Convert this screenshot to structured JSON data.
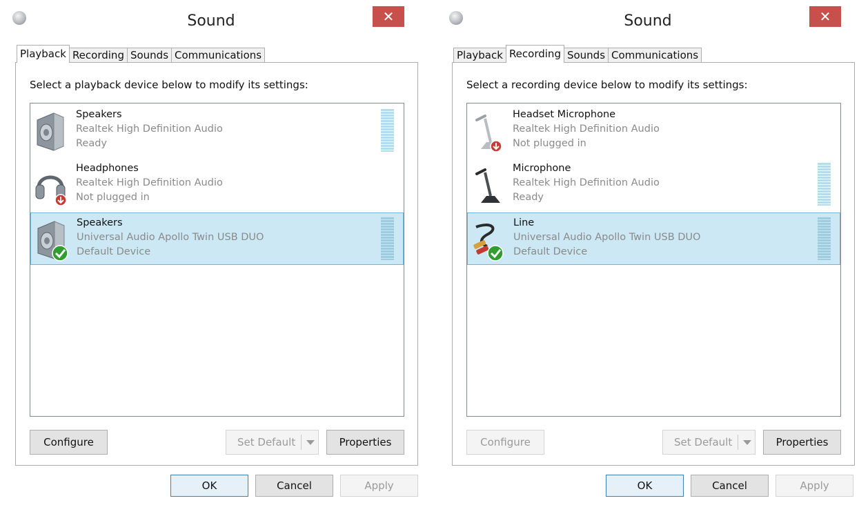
{
  "dialogs": [
    {
      "title": "Sound",
      "close_label": "✕",
      "tabs": [
        "Playback",
        "Recording",
        "Sounds",
        "Communications"
      ],
      "active_tab": "Playback",
      "instruction": "Select a playback device below to modify its settings:",
      "devices": [
        {
          "name": "Speakers",
          "driver": "Realtek High Definition Audio",
          "status": "Ready",
          "icon": "speaker-icon",
          "badge": "none",
          "meter": true,
          "selected": false
        },
        {
          "name": "Headphones",
          "driver": "Realtek High Definition Audio",
          "status": "Not plugged in",
          "icon": "headphones-icon",
          "badge": "unplugged",
          "meter": false,
          "selected": false
        },
        {
          "name": "Speakers",
          "driver": "Universal Audio Apollo Twin USB DUO",
          "status": "Default Device",
          "icon": "speaker-icon",
          "badge": "default-check",
          "meter": true,
          "selected": true
        }
      ],
      "buttons": {
        "configure": "Configure",
        "set_default": "Set Default",
        "properties": "Properties",
        "ok": "OK",
        "cancel": "Cancel",
        "apply": "Apply"
      },
      "configure_enabled": true
    },
    {
      "title": "Sound",
      "close_label": "✕",
      "tabs": [
        "Playback",
        "Recording",
        "Sounds",
        "Communications"
      ],
      "active_tab": "Recording",
      "instruction": "Select a recording device below to modify its settings:",
      "devices": [
        {
          "name": "Headset Microphone",
          "driver": "Realtek High Definition Audio",
          "status": "Not plugged in",
          "icon": "microphone-icon",
          "badge": "unplugged",
          "meter": false,
          "selected": false
        },
        {
          "name": "Microphone",
          "driver": "Realtek High Definition Audio",
          "status": "Ready",
          "icon": "microphone-icon",
          "badge": "none",
          "meter": true,
          "selected": false
        },
        {
          "name": "Line",
          "driver": "Universal Audio Apollo Twin USB DUO",
          "status": "Default Device",
          "icon": "line-in-cable-icon",
          "badge": "default-check",
          "meter": true,
          "selected": true
        }
      ],
      "buttons": {
        "configure": "Configure",
        "set_default": "Set Default",
        "properties": "Properties",
        "ok": "OK",
        "cancel": "Cancel",
        "apply": "Apply"
      },
      "configure_enabled": false
    }
  ],
  "colors": {
    "selection": "#cce8f4",
    "selection_border": "#6fb5d9",
    "close": "#c7504c",
    "meter": "#b8dbe8",
    "check": "#2f9e2f",
    "unplug": "#c73a35"
  }
}
